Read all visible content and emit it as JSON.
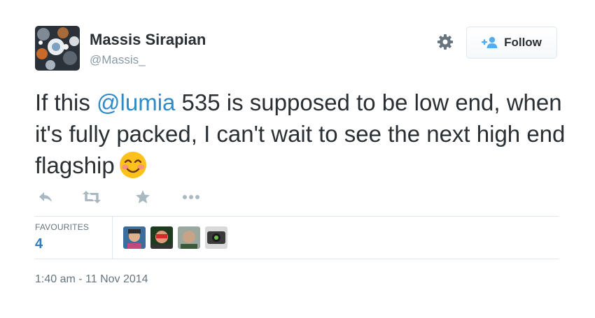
{
  "author": {
    "name": "Massis Sirapian",
    "handle": "@Massis_"
  },
  "header": {
    "follow_label": "Follow"
  },
  "tweet": {
    "text_before": "If this ",
    "mention": "@lumia",
    "text_after": " 535 is supposed to be low end, when it's fully packed, I can't wait to see the next high end flagship"
  },
  "stats": {
    "favourites_label": "FAVOURITES",
    "favourites_count": "4"
  },
  "timestamp": "1:40 am - 11 Nov 2014",
  "colors": {
    "link": "#2f8bc8",
    "count": "#2f7bbf",
    "follow_icon": "#55acee",
    "icon_gray": "#8899a6"
  },
  "icons": [
    "settings-gear-icon",
    "follow-person-icon",
    "reply-icon",
    "retweet-icon",
    "favourite-star-icon",
    "more-icon",
    "smiling-face-emoji"
  ]
}
